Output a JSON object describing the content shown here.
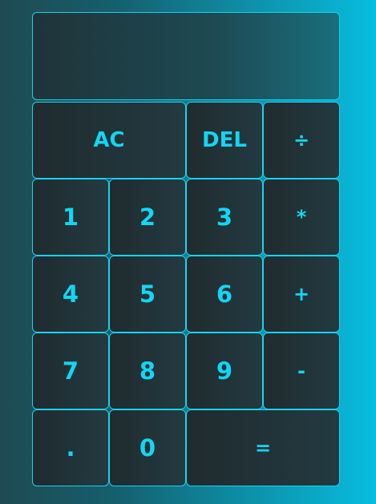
{
  "display": {
    "value": ""
  },
  "keys": {
    "ac": "AC",
    "del": "DEL",
    "divide": "÷",
    "one": "1",
    "two": "2",
    "three": "3",
    "multiply": "*",
    "four": "4",
    "five": "5",
    "six": "6",
    "add": "+",
    "seven": "7",
    "eight": "8",
    "nine": "9",
    "subtract": "-",
    "decimal": ".",
    "zero": "0",
    "equals": "="
  },
  "colors": {
    "accent": "#12d6f5",
    "key_bg": "#223a41",
    "bg_left": "#1f4a52",
    "bg_right": "#07bde0"
  }
}
